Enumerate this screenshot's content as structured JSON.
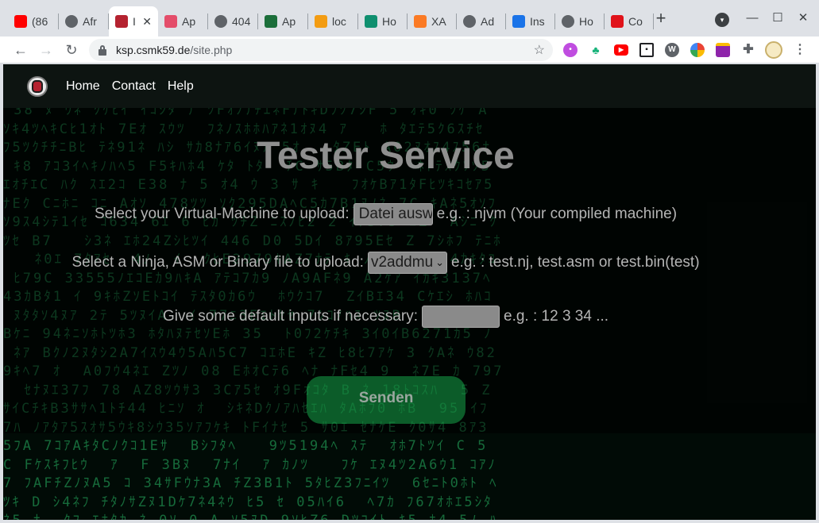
{
  "browser": {
    "tabs": [
      {
        "label": "(86",
        "icon": "youtube-icon",
        "color": "#ff0000"
      },
      {
        "label": "Afr",
        "icon": "globe-icon",
        "color": "#5f6368"
      },
      {
        "label": "I",
        "icon": "site-favicon-icon",
        "color": "#b52230"
      },
      {
        "label": "Ap",
        "icon": "apache-icon",
        "color": "#e44d6a"
      },
      {
        "label": "404",
        "icon": "globe-icon",
        "color": "#5f6368"
      },
      {
        "label": "Ap",
        "icon": "android-studio-icon",
        "color": "#1b6e3a"
      },
      {
        "label": "loc",
        "icon": "phpmyadmin-icon",
        "color": "#f39c12"
      },
      {
        "label": "Ho",
        "icon": "ut-icon",
        "color": "#0f8f6f"
      },
      {
        "label": "XA",
        "icon": "xampp-icon",
        "color": "#fb7a24"
      },
      {
        "label": "Ad",
        "icon": "globe-icon",
        "color": "#5f6368"
      },
      {
        "label": "Ins",
        "icon": "loader-icon",
        "color": "#1a73e8"
      },
      {
        "label": "Ho",
        "icon": "globe-icon",
        "color": "#5f6368"
      },
      {
        "label": "Co",
        "icon": "r-icon",
        "color": "#e0121a"
      }
    ],
    "tab_close": "✕",
    "new_tab": "+",
    "url_host": "ksp.csmk59.de",
    "url_path": "/site.php"
  },
  "nav": {
    "links": [
      "Home",
      "Contact",
      "Help"
    ]
  },
  "page": {
    "title": "Tester Service",
    "vm_label": "Select your Virtual-Machine to upload:",
    "vm_file_button": "Datei ausw",
    "vm_hint": "e.g. : njvm (Your compiled machine)",
    "file_label": "Select a Ninja, ASM or Binary file to upload:",
    "file_selected": "v2addmu",
    "file_hint": "e.g. : test.nj, test.asm or test.bin(test)",
    "inputs_label": "Give some default inputs if necessary:",
    "inputs_value": "",
    "inputs_hint": "e.g. : 12 3 34 ...",
    "submit_label": "Senden"
  },
  "colors": {
    "matrix_green": "#1b7a44",
    "matrix_bright": "#2fd36e",
    "submit_bg": "#1ac858"
  }
}
